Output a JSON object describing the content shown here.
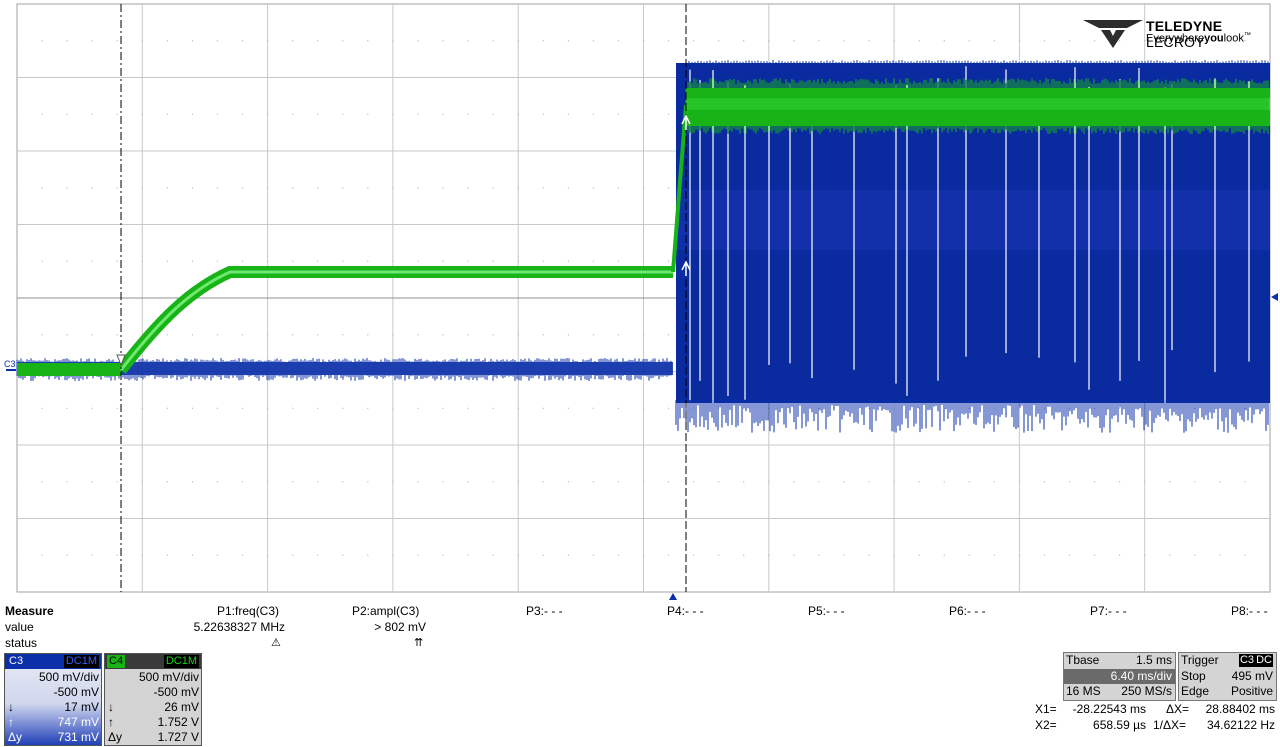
{
  "brand": {
    "name_bold": "TELEDYNE",
    "name_rest": " LECROY",
    "tagline_a": "Everywhere",
    "tagline_b": "you",
    "tagline_c": "look",
    "tagline_tm": "™"
  },
  "colors": {
    "c3": "#0b2fa8",
    "c4": "#17b317",
    "grid": "#c8c8c8"
  },
  "markers": {
    "c3_label": "C3",
    "trigger_level_icon": "triangle-left-icon",
    "trigger_pos_icon": "triangle-up-icon"
  },
  "measure": {
    "title": "Measure",
    "row_value": "value",
    "row_status": "status",
    "params": [
      {
        "label": "P1:freq(C3)",
        "value": "5.22638327 MHz",
        "status_icon": "warning-icon",
        "status": "⚠"
      },
      {
        "label": "P2:ampl(C3)",
        "value": "> 802 mV",
        "status_icon": "up-arrows-icon",
        "status": "⇈"
      },
      {
        "label": "P3:- - -"
      },
      {
        "label": "P4:- - -"
      },
      {
        "label": "P5:- - -"
      },
      {
        "label": "P6:- - -"
      },
      {
        "label": "P7:- - -"
      },
      {
        "label": "P8:- - -"
      }
    ]
  },
  "channels": [
    {
      "id": "C3",
      "coupling": "DC1M",
      "vdiv": "500 mV/div",
      "offset": "-500 mV",
      "cur1_sym": "↓",
      "cur1": "17 mV",
      "cur2_sym": "↑",
      "cur2": "747 mV",
      "delta_sym": "Δy",
      "delta": "731 mV"
    },
    {
      "id": "C4",
      "coupling": "DC1M",
      "vdiv": "500 mV/div",
      "offset": "-500 mV",
      "cur1_sym": "↓",
      "cur1": "26 mV",
      "cur2_sym": "↑",
      "cur2": "1.752 V",
      "delta_sym": "Δy",
      "delta": "1.727 V"
    }
  ],
  "timebase": {
    "label": "Tbase",
    "value": "1.5 ms",
    "tdiv": "6.40 ms/div",
    "samples": "16 MS",
    "rate": "250 MS/s"
  },
  "trigger": {
    "label": "Trigger",
    "source": "C3",
    "coupling": "DC",
    "mode": "Stop",
    "level": "495 mV",
    "type": "Edge",
    "slope": "Positive"
  },
  "cursors": {
    "x1_label": "X1=",
    "x1": "-28.22543 ms",
    "dx_label": "ΔX=",
    "dx": "28.88402 ms",
    "x2_label": "X2=",
    "x2": "658.59 µs",
    "inv_label": "1/ΔX=",
    "inv": "34.62122 Hz"
  }
}
